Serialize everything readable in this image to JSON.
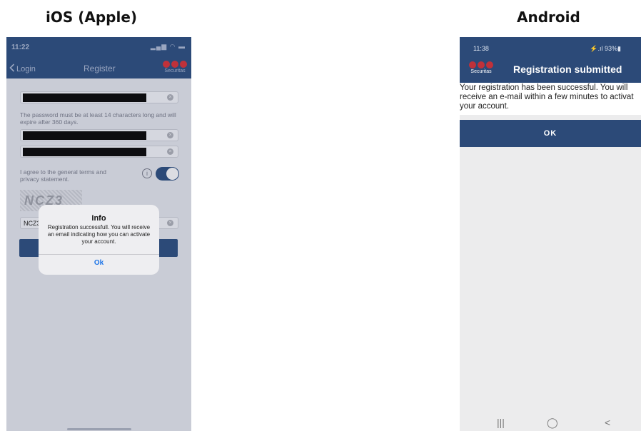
{
  "headings": {
    "ios": "iOS (Apple)",
    "android": "Android"
  },
  "ios": {
    "status_time": "11:22",
    "status_icons": "▂▄▆ ◠ ▬",
    "nav_back": "Login",
    "nav_title": "Register",
    "logo_text": "Securitas",
    "password_hint": "The password must be at least 14 characters long and will expire after 360 days.",
    "terms_text": "I agree to the general terms and privacy statement.",
    "captcha_text": "NCZ3",
    "code_value": "NCZ3",
    "alert": {
      "title": "Info",
      "message": "Registration successfull. You will receive an email indicating how you can activate your account.",
      "ok": "Ok"
    },
    "colors": {
      "nav": "#2c4a78",
      "overlay": "#c9ccd6",
      "accent": "#c0313a"
    }
  },
  "android": {
    "status_time": "11:38",
    "status_icons": "⚡.ıl 93%▮",
    "logo_text": "Securitas",
    "title": "Registration submitted",
    "menu_icon": "⋮",
    "message": "Your registration has been successful. You will receive an e-mail within a few minutes to activate your account.",
    "message_lines": [
      "Your registration has been successful. You will",
      "receive an e-mail within a few minutes to activat",
      "your account."
    ],
    "ok_button": "OK",
    "navbar": {
      "recents": "|||",
      "home": "◯",
      "back": "<"
    },
    "colors": {
      "bar": "#2c4a78",
      "background": "#ececed"
    }
  }
}
